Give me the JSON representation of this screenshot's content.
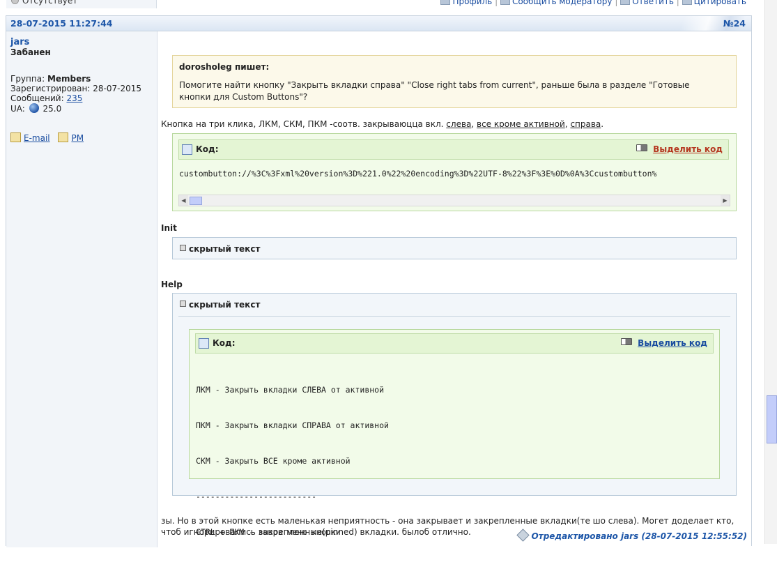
{
  "top_bar": {
    "status": "Отсутствует",
    "links": [
      "Профиль",
      "Сообщить модератору",
      "Ответить",
      "Цитировать"
    ],
    "separator": "|"
  },
  "post": {
    "date": "28-07-2015 11:27:44",
    "number": "№24",
    "user": {
      "name": "jars",
      "title": "Забанен",
      "group_label": "Группа:",
      "group": "Members",
      "registered_label": "Зарегистрирован:",
      "registered": "28-07-2015",
      "messages_label": "Сообщений:",
      "messages": "235",
      "ua_label": "UA:",
      "ua_version": "25.0",
      "email_link": "E-mail",
      "pm_link": "PM"
    },
    "quote": {
      "author": "dorosholeg пишет:",
      "text": "Помогите найти кнопку \"Закрыть вкладки справа\" \"Close right tabs from current\", раньше была в разделе \"Готовые кнопки для Custom Buttons\"?"
    },
    "intro": {
      "prefix": "Кнопка на три клика, ЛКМ, СКМ, ПКМ -соотв. закрываюцца вкл. ",
      "link1": "слева",
      "sep1": ", ",
      "link2": "все кроме активной",
      "sep2": ", ",
      "link3": "справа",
      "suffix": "."
    },
    "code1": {
      "title": "Код:",
      "select_label": "Выделить код",
      "content": "custombutton://%3C%3Fxml%20version%3D%221.0%22%20encoding%3D%22UTF-8%22%3F%3E%0D%0A%3Ccustombutton%"
    },
    "init_heading": "Init",
    "spoiler1_label": "скрытый текст",
    "help_heading": "Help",
    "spoiler2_label": "скрытый текст",
    "code2": {
      "title": "Код:",
      "select_label": "Выделить код",
      "lines": [
        "ЛКМ - Закрыть вкладки СЛЕВА от активной",
        "ПКМ - Закрыть вкладки СПРАВА от активной",
        "СКМ - Закрыть ВСЕ кроме активной",
        "-------------------------",
        "CTRL + ПКМ - вызов меню кнопки"
      ]
    },
    "outro": "зы. Но в этой кнопке есть маленькая неприятность - она закрывает и закрепленные вкладки(те шо слева). Могет доделает кто, чтоб игнорировались закрепленные(pinned) вкладки. былоб отлично.",
    "edited": "Отредактировано jars (28-07-2015 12:55:52)"
  },
  "colors": {
    "link": "#1a4da0",
    "header_text": "#1d56a8",
    "select_active": "#b5371f",
    "code_bg": "#f2fbe9",
    "quote_bg": "#fcf9ea"
  }
}
